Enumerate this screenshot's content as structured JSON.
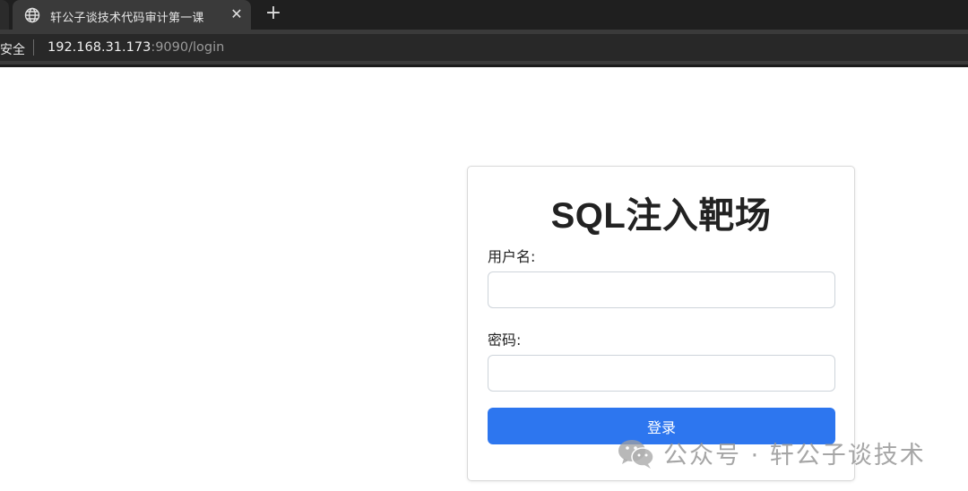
{
  "browser": {
    "tab": {
      "title": "轩公子谈技术代码审计第一课",
      "close_glyph": "✕",
      "icon": "globe-icon"
    },
    "new_tab_glyph": "+",
    "address": {
      "security_label": "安全",
      "url_host": "192.168.31.173",
      "url_rest": ":9090/login"
    }
  },
  "login": {
    "title": "SQL注入靶场",
    "username_label": "用户名:",
    "username_value": "",
    "password_label": "密码:",
    "password_value": "",
    "submit_label": "登录"
  },
  "watermark": {
    "text": "公众号 · 轩公子谈技术",
    "icon": "wechat-icon"
  },
  "colors": {
    "accent": "#2d76ef",
    "chrome_dark": "#1f1f1f",
    "chrome_tab": "#3a3a3a"
  }
}
